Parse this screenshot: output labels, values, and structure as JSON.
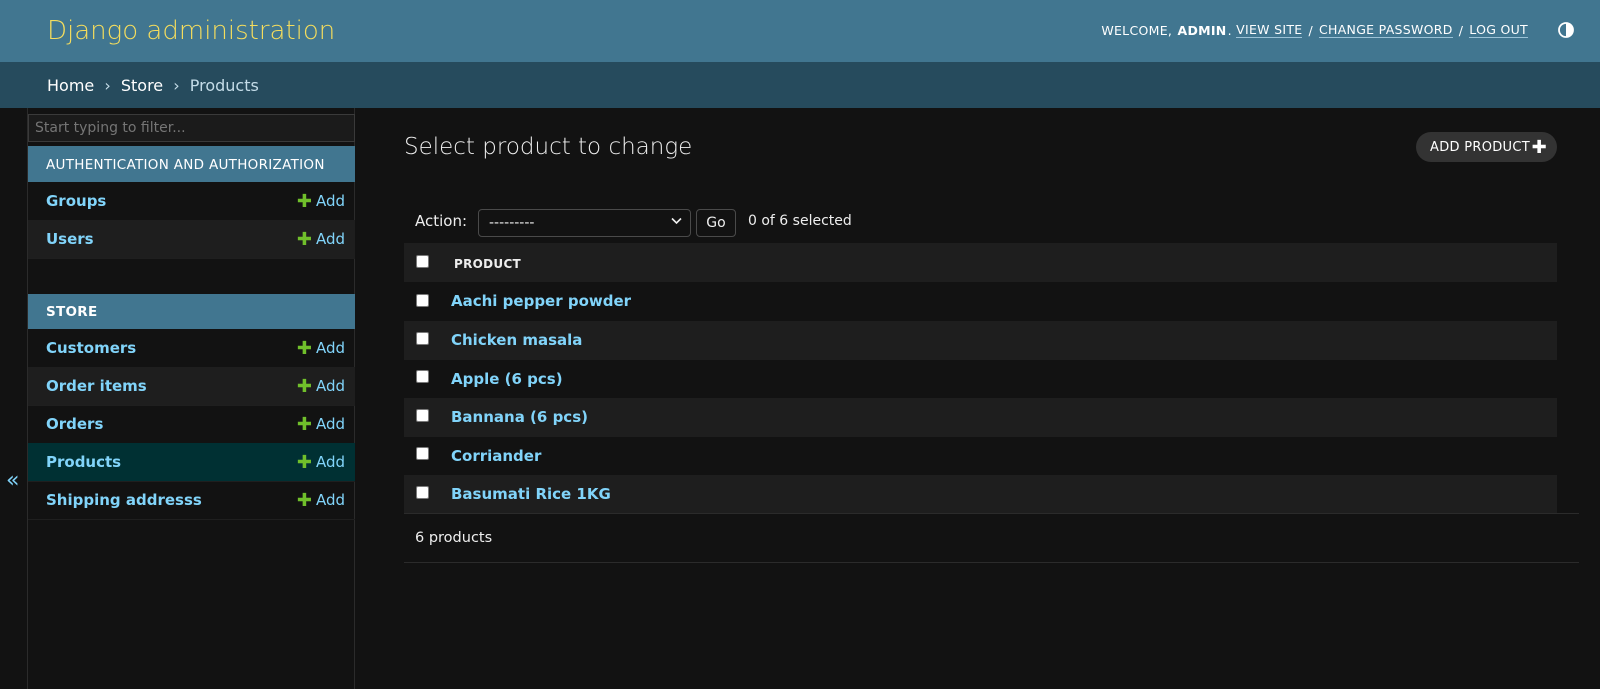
{
  "header": {
    "brand": "Django administration",
    "welcome": "WELCOME,",
    "username": "ADMIN",
    "view_site": "VIEW SITE",
    "change_password": "CHANGE PASSWORD",
    "log_out": "LOG OUT",
    "separator": "/"
  },
  "breadcrumbs": {
    "items": [
      "Home",
      "Store",
      "Products"
    ],
    "separator": "›"
  },
  "sidebar": {
    "filter_placeholder": "Start typing to filter...",
    "collapse_glyph": "«",
    "modules": [
      {
        "caption": "AUTHENTICATION AND AUTHORIZATION",
        "models": [
          {
            "label": "Groups",
            "add": "Add"
          },
          {
            "label": "Users",
            "add": "Add"
          }
        ]
      },
      {
        "caption": "STORE",
        "models": [
          {
            "label": "Customers",
            "add": "Add"
          },
          {
            "label": "Order items",
            "add": "Add"
          },
          {
            "label": "Orders",
            "add": "Add"
          },
          {
            "label": "Products",
            "add": "Add",
            "active": true
          },
          {
            "label": "Shipping addresss",
            "add": "Add"
          }
        ]
      }
    ]
  },
  "main": {
    "title": "Select product to change",
    "add_button": "ADD PRODUCT",
    "action_label": "Action:",
    "action_selected": "---------",
    "go_button": "Go",
    "selected_count": "0 of 6 selected",
    "column_header": "PRODUCT",
    "rows": [
      "Aachi pepper powder",
      "Chicken masala",
      "Apple (6 pcs)",
      "Bannana (6 pcs)",
      "Corriander",
      "Basumati Rice 1KG"
    ],
    "paginator": "6 products"
  },
  "colors": {
    "header_bg": "#417690",
    "brand": "#f5dd5d",
    "breadcrumbs_bg": "#264b5d",
    "link": "#81d4fa",
    "add_plus": "#70bf2b",
    "active_row": "#003033",
    "background": "#121212"
  }
}
